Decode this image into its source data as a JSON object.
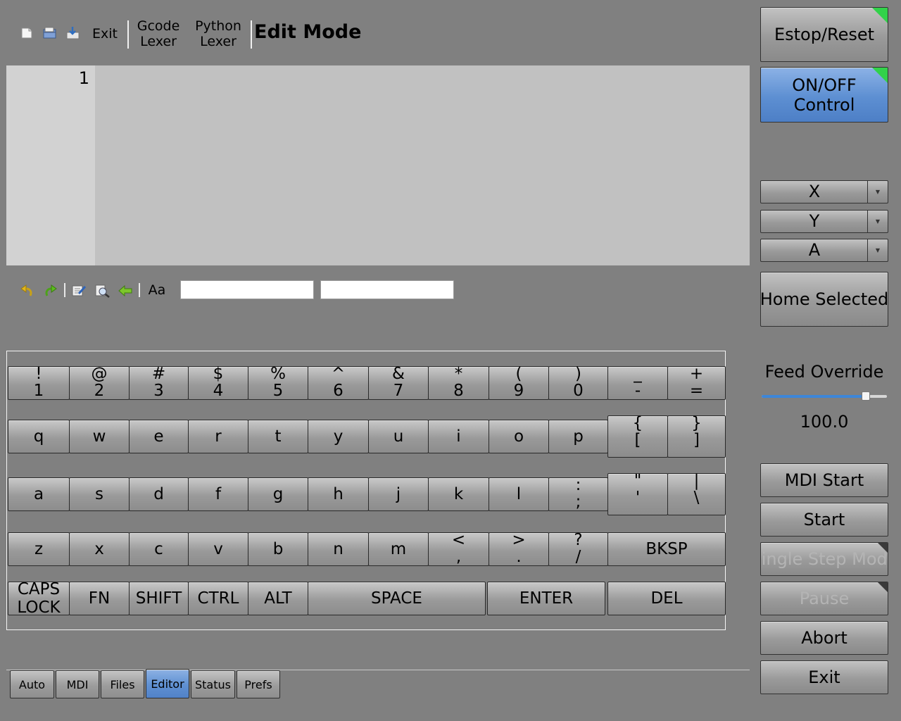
{
  "toolbar": {
    "new_icon": "new-file-icon",
    "open_icon": "open-file-icon",
    "save_icon": "save-file-icon",
    "exit_label": "Exit",
    "gcode_lexer_l1": "Gcode",
    "gcode_lexer_l2": "Lexer",
    "python_lexer_l1": "Python",
    "python_lexer_l2": "Lexer",
    "mode_title": "Edit Mode"
  },
  "editor": {
    "line_number": "1"
  },
  "search_bar": {
    "case_label": "Aa",
    "search_value": "",
    "replace_value": ""
  },
  "keyboard": {
    "row1": [
      {
        "up": "!",
        "lo": "1"
      },
      {
        "up": "@",
        "lo": "2"
      },
      {
        "up": "#",
        "lo": "3"
      },
      {
        "up": "$",
        "lo": "4"
      },
      {
        "up": "%",
        "lo": "5"
      },
      {
        "up": "^",
        "lo": "6"
      },
      {
        "up": "&",
        "lo": "7"
      },
      {
        "up": "*",
        "lo": "8"
      },
      {
        "up": "(",
        "lo": "9"
      },
      {
        "up": ")",
        "lo": "0"
      },
      {
        "up": "_",
        "lo": "-"
      },
      {
        "up": "+",
        "lo": "="
      }
    ],
    "row2": [
      "q",
      "w",
      "e",
      "r",
      "t",
      "y",
      "u",
      "i",
      "o",
      "p"
    ],
    "row2_sym": [
      {
        "up": "{",
        "lo": "["
      },
      {
        "up": "}",
        "lo": "]"
      }
    ],
    "row3": [
      "a",
      "s",
      "d",
      "f",
      "g",
      "h",
      "j",
      "k",
      "l"
    ],
    "row3_sym": [
      {
        "up": ":",
        "lo": ";"
      },
      {
        "up": "\"",
        "lo": "'"
      },
      {
        "up": "|",
        "lo": "\\"
      }
    ],
    "row4": [
      "z",
      "x",
      "c",
      "v",
      "b",
      "n",
      "m"
    ],
    "row4_sym": [
      {
        "up": "<",
        "lo": ","
      },
      {
        "up": ">",
        "lo": "."
      },
      {
        "up": "?",
        "lo": "/"
      }
    ],
    "bksp": "BKSP",
    "caps_l1": "CAPS",
    "caps_l2": "LOCK",
    "fn": "FN",
    "shift": "SHIFT",
    "ctrl": "CTRL",
    "alt": "ALT",
    "space": "SPACE",
    "enter": "ENTER",
    "del": "DEL"
  },
  "panel": {
    "estop": "Estop/Reset",
    "onoff_l1": "ON/OFF",
    "onoff_l2": "Control",
    "axes": [
      "X",
      "Y",
      "A"
    ],
    "home_selected": "Home Selected",
    "feed_override_label": "Feed Override",
    "feed_override_value": "100.0",
    "feed_override_fraction": 0.83,
    "mdi_start": "MDI Start",
    "start": "Start",
    "single_step": "Single Step Mode",
    "pause": "Pause",
    "abort": "Abort",
    "exit": "Exit"
  },
  "tabs": [
    {
      "label": "Auto",
      "active": false
    },
    {
      "label": "MDI",
      "active": false
    },
    {
      "label": "Files",
      "active": false
    },
    {
      "label": "Editor",
      "active": true
    },
    {
      "label": "Status",
      "active": false
    },
    {
      "label": "Prefs",
      "active": false
    }
  ],
  "colors": {
    "background": "#808080",
    "accent_blue": "#5d8fd2",
    "indicator_green": "#32d24a"
  }
}
